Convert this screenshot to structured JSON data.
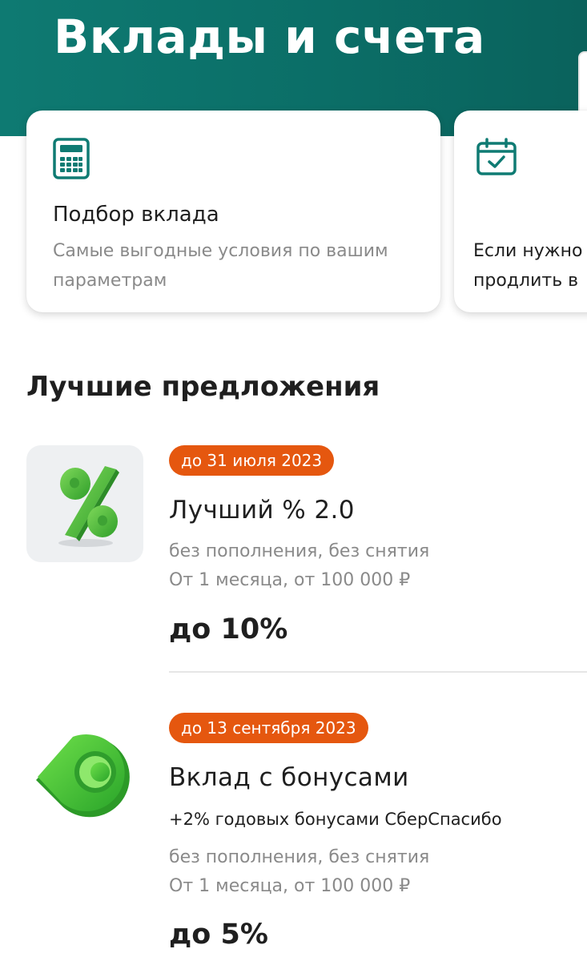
{
  "header": {
    "title": "Вклады и счета"
  },
  "cards": [
    {
      "icon": "calculator-icon",
      "title": "Подбор вклада",
      "description": "Самые выгодные условия по вашим параметрам"
    },
    {
      "icon": "calendar-check-icon",
      "description": "Если нужно\nпродлить в"
    }
  ],
  "section": {
    "title": "Лучшие предложения"
  },
  "offers": [
    {
      "image": "percent-3d-icon",
      "deadline": "до 31 июля 2023",
      "name": "Лучший % 2.0",
      "conditions": "без пополнения, без снятия",
      "term": "От 1 месяца, от 100 000 ₽",
      "rate": "до 10%"
    },
    {
      "image": "sberspasibo-3d-icon",
      "deadline": "до 13 сентября 2023",
      "name": "Вклад с бонусами",
      "bonus": "+2% годовых бонусами СберСпасибо",
      "conditions": "без пополнения, без снятия",
      "term": "От 1 месяца, от 100 000 ₽",
      "rate": "до 5%"
    }
  ],
  "colors": {
    "header": "#0b6e67",
    "accent": "#0f7b73",
    "badge": "#e5570f",
    "secondary_text": "#8a8a8a"
  }
}
